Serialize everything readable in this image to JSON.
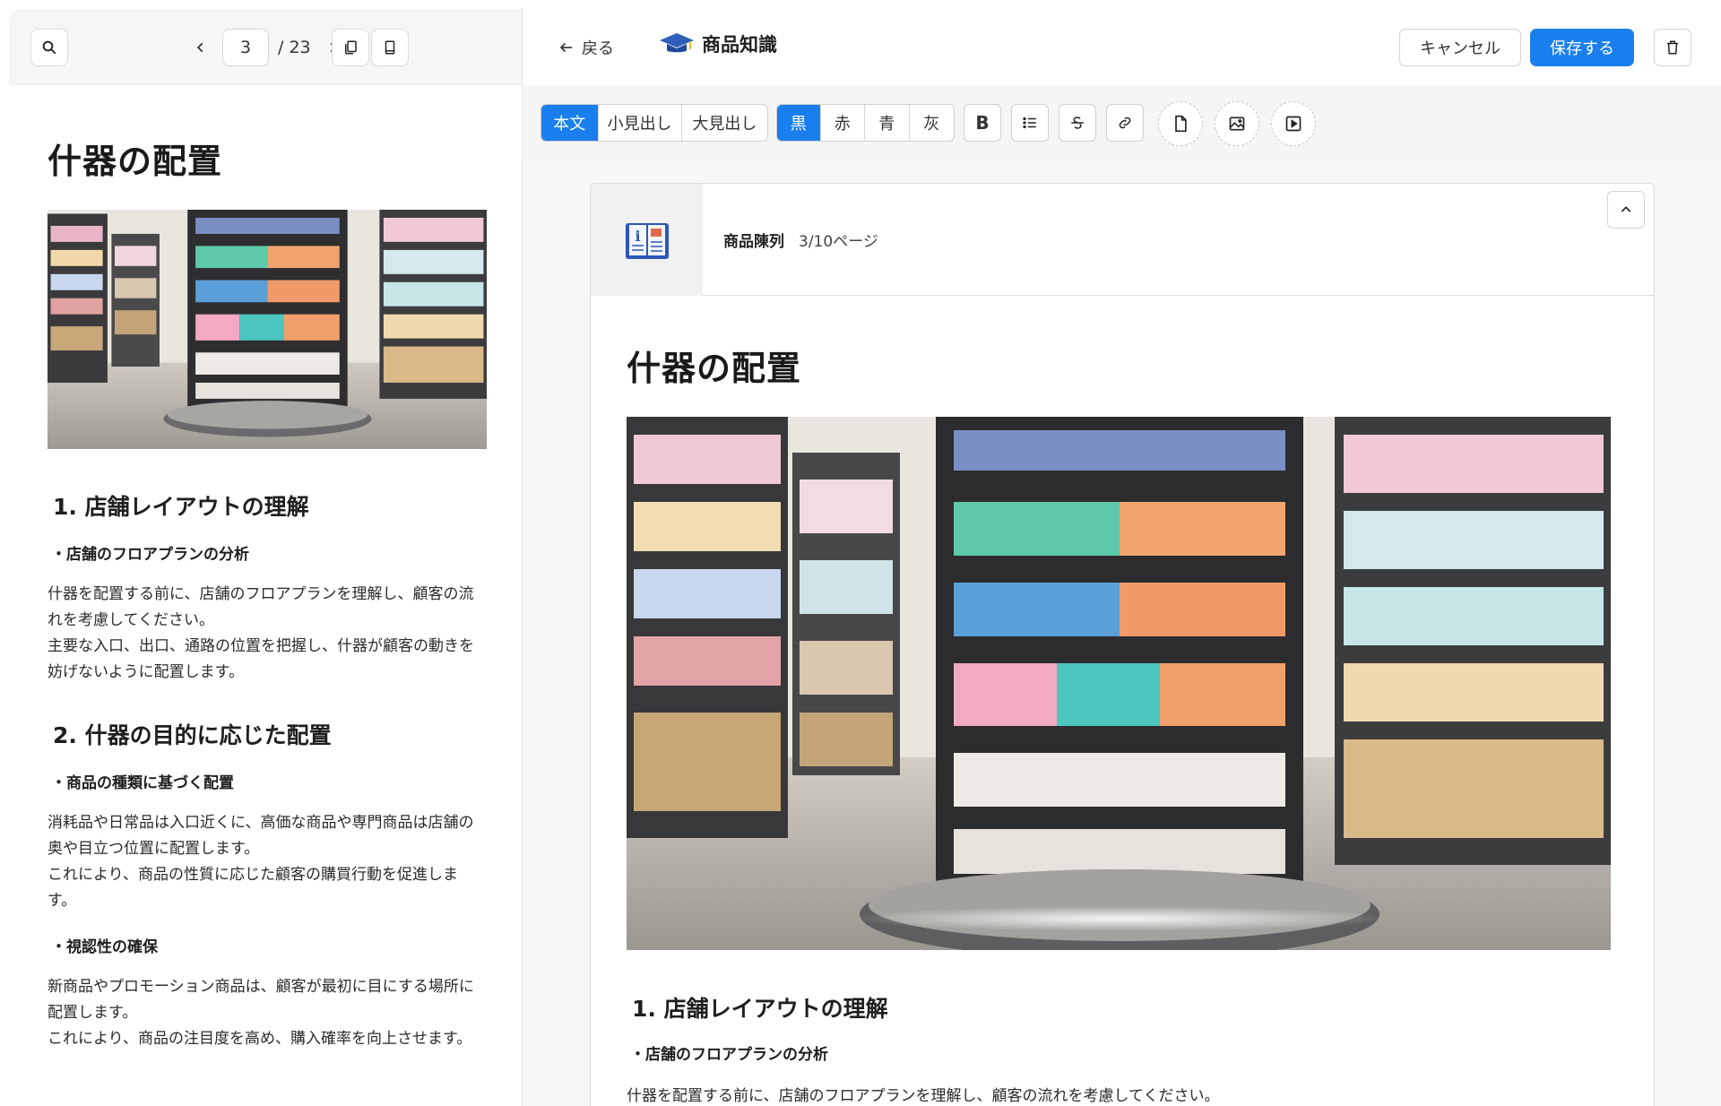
{
  "preview": {
    "page_current": "3",
    "page_total": "/ 23",
    "title": "什器の配置",
    "image_alt": "store-shelf-display-photo",
    "section1_heading": "1. 店舗レイアウトの理解",
    "section1_sub": "・店舗のフロアプランの分析",
    "section1_text1": "什器を配置する前に、店舗のフロアプランを理解し、顧客の流れを考慮してください。",
    "section1_text2": "主要な入口、出口、通路の位置を把握し、什器が顧客の動きを妨げないように配置します。",
    "section2_heading": "2. 什器の目的に応じた配置",
    "section2_sub1": "・商品の種類に基づく配置",
    "section2_text1": "消耗品や日常品は入口近くに、高価な商品や専門商品は店舗の奥や目立つ位置に配置します。",
    "section2_text2": "これにより、商品の性質に応じた顧客の購買行動を促進します。",
    "section2_sub2": "・視認性の確保",
    "section2_text3": "新商品やプロモーション商品は、顧客が最初に目にする場所に配置します。",
    "section2_text4": "これにより、商品の注目度を高め、購入確率を向上させます。"
  },
  "header": {
    "back_label": "戻る",
    "brand_label": "商品知識",
    "cancel_label": "キャンセル",
    "save_label": "保存する"
  },
  "toolbar": {
    "text_styles": [
      "本文",
      "小見出し",
      "大見出し"
    ],
    "colors": [
      "黒",
      "赤",
      "青",
      "灰"
    ],
    "bold_label": "B"
  },
  "editor": {
    "card_title": "商品陳列",
    "card_page": "3/10ページ",
    "title": "什器の配置",
    "section1_heading": "1. 店舗レイアウトの理解",
    "section1_sub": "・店舗のフロアプランの分析",
    "section1_text": "什器を配置する前に、店舗のフロアプランを理解し、顧客の流れを考慮してください。"
  },
  "colors": {
    "accent": "#1a7fee",
    "toolbar_bg": "#f5f5f5",
    "border": "#dcdcdc"
  }
}
